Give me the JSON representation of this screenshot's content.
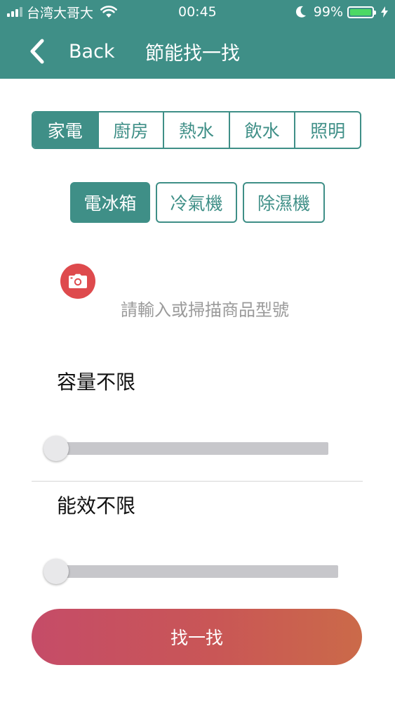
{
  "status_bar": {
    "carrier": "台湾大哥大",
    "time": "00:45",
    "battery_percent": "99%",
    "battery_level": 0.99,
    "signal_bars": 4,
    "signal_active": 3,
    "icons": [
      "signal-icon",
      "wifi-icon",
      "moon-icon",
      "battery-icon",
      "charging-icon"
    ],
    "accent_battery": "#4cd964"
  },
  "nav": {
    "back_label": "Back",
    "title": "節能找一找",
    "background": "#3f8f87"
  },
  "categories": {
    "items": [
      "家電",
      "廚房",
      "熱水",
      "飲水",
      "照明"
    ],
    "active_index": 0
  },
  "sub_categories": {
    "items": [
      "電冰箱",
      "冷氣機",
      "除濕機"
    ],
    "active_index": 0
  },
  "search": {
    "placeholder": "請輸入或掃描商品型號",
    "value": "",
    "camera_icon": "camera-icon",
    "camera_color": "#de4a4d"
  },
  "filters": {
    "capacity": {
      "label": "容量不限",
      "value": 0
    },
    "efficiency": {
      "label": "能效不限",
      "value": 0
    }
  },
  "action": {
    "label": "找一找",
    "gradient": [
      "#c54c68",
      "#cb6a49"
    ]
  }
}
